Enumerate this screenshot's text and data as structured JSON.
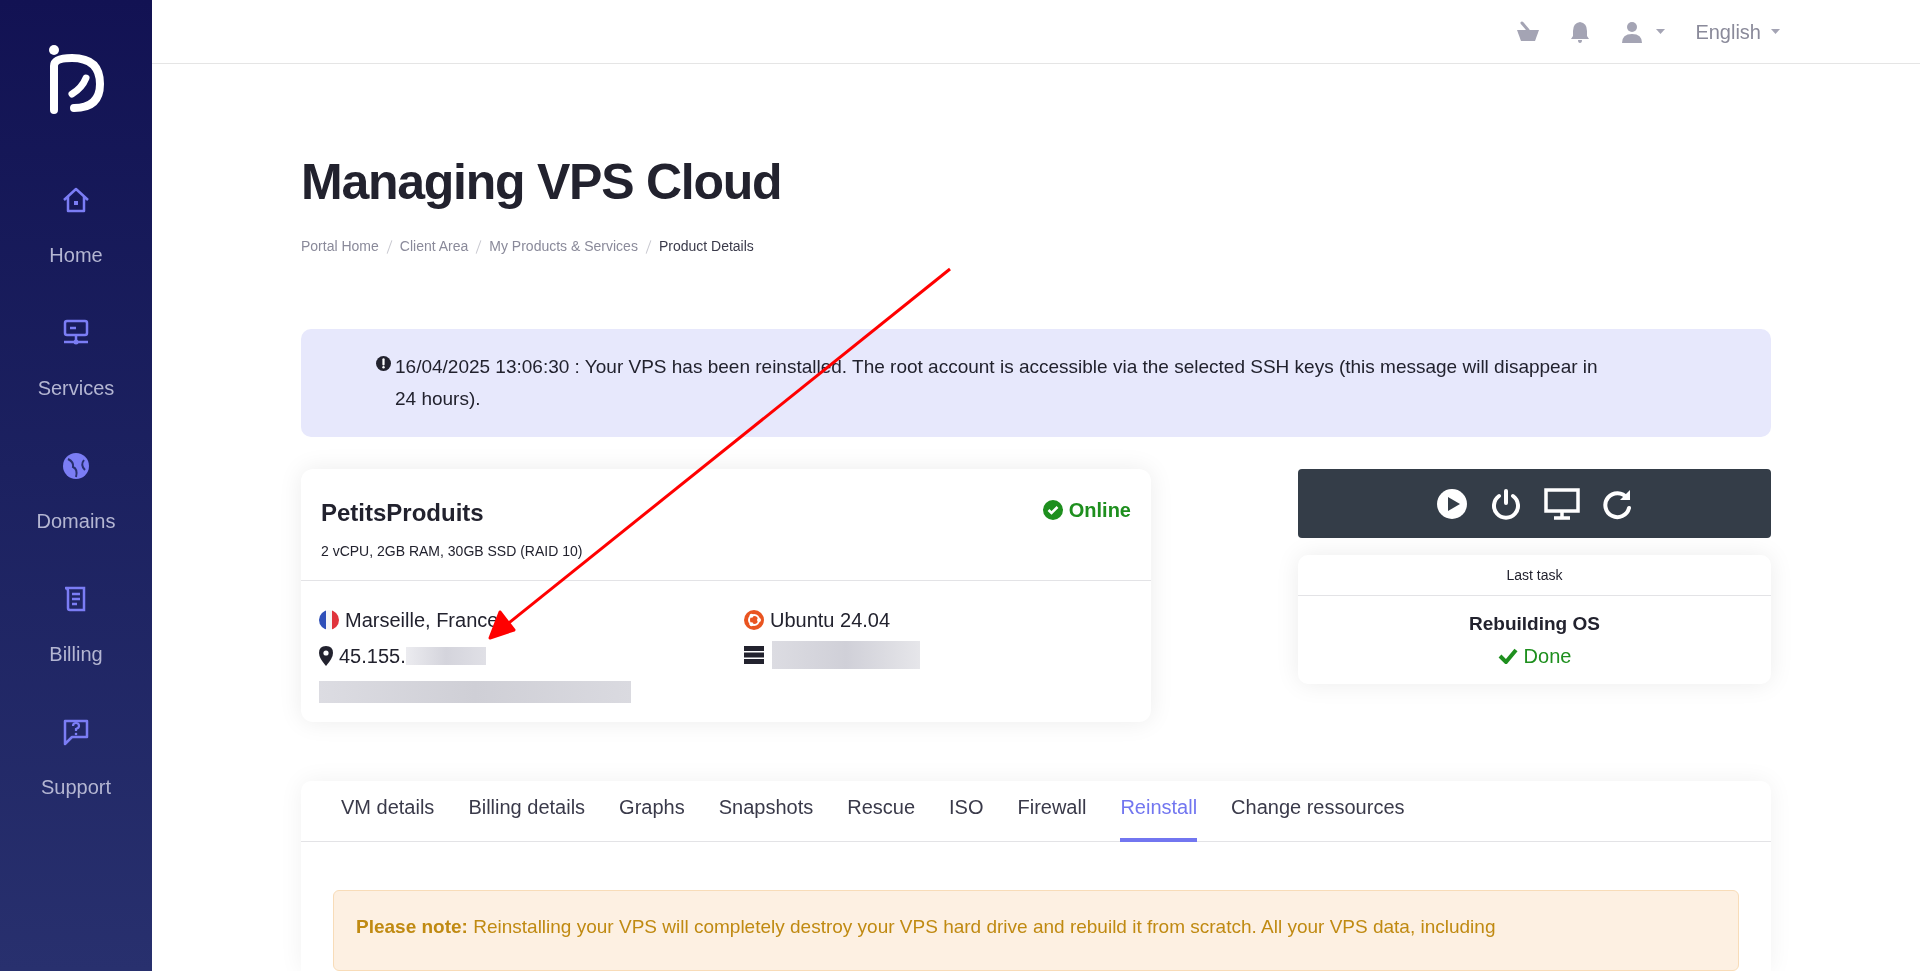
{
  "sidebar": {
    "items": [
      {
        "kind": "home",
        "label": "Home"
      },
      {
        "kind": "services",
        "label": "Services"
      },
      {
        "kind": "domains",
        "label": "Domains"
      },
      {
        "kind": "billing",
        "label": "Billing"
      },
      {
        "kind": "support",
        "label": "Support"
      }
    ]
  },
  "topbar": {
    "language": "English"
  },
  "page": {
    "title": "Managing VPS Cloud",
    "breadcrumb": [
      {
        "label": "Portal Home",
        "selected": false
      },
      {
        "label": "Client Area",
        "selected": false
      },
      {
        "label": "My Products & Services",
        "selected": false
      },
      {
        "label": "Product Details",
        "selected": true
      }
    ]
  },
  "alert": {
    "text": "16/04/2025 13:06:30 : Your VPS has been reinstalled. The root account is accessible via the selected SSH keys (this message will disappear in 24 hours)."
  },
  "server": {
    "name": "PetitsProduits",
    "specs": "2 vCPU, 2GB RAM, 30GB SSD (RAID 10)",
    "status": "Online",
    "online": true,
    "location": "Marseille, France",
    "ip": "45.155.",
    "os": "Ubuntu 24.04"
  },
  "last_task": {
    "heading": "Last task",
    "task": "Rebuilding OS",
    "result": "Done",
    "done": true
  },
  "tabs": [
    {
      "label": "VM details",
      "selected": false
    },
    {
      "label": "Billing details",
      "selected": false
    },
    {
      "label": "Graphs",
      "selected": false
    },
    {
      "label": "Snapshots",
      "selected": false
    },
    {
      "label": "Rescue",
      "selected": false
    },
    {
      "label": "ISO",
      "selected": false
    },
    {
      "label": "Firewall",
      "selected": false
    },
    {
      "label": "Reinstall",
      "selected": true
    },
    {
      "label": "Change ressources",
      "selected": false
    }
  ],
  "note": {
    "text": "**Please note:** Reinstalling your VPS will completely destroy your VPS hard drive and rebuild it from scratch. All your VPS data, including"
  }
}
